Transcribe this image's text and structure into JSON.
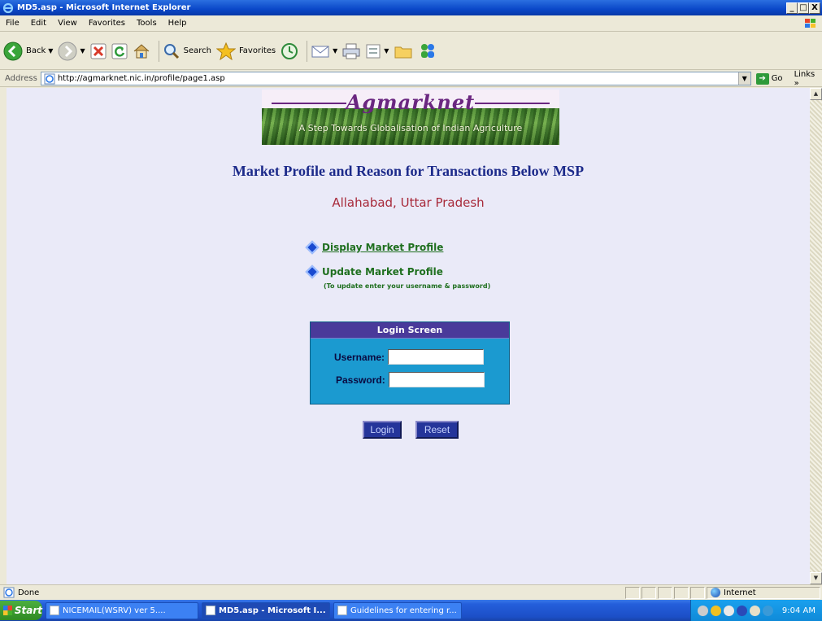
{
  "window": {
    "title": "MD5.asp - Microsoft Internet Explorer",
    "controls": {
      "minimize": "_",
      "maximize": "□",
      "close": "X"
    }
  },
  "menubar": {
    "items": [
      "File",
      "Edit",
      "View",
      "Favorites",
      "Tools",
      "Help"
    ]
  },
  "toolbar": {
    "back_label": "Back",
    "search_label": "Search",
    "favorites_label": "Favorites"
  },
  "address": {
    "label": "Address",
    "url": "http://agmarknet.nic.in/profile/page1.asp",
    "go_label": "Go",
    "links_label": "Links »"
  },
  "page": {
    "brand": "Agmarknet",
    "tagline": "A Step Towards Globalisation of Indian Agriculture",
    "heading": "Market Profile and Reason for Transactions Below MSP",
    "location": "Allahabad, Uttar Pradesh",
    "links": [
      {
        "label": "Display Market Profile"
      },
      {
        "label": "Update Market Profile"
      }
    ],
    "update_note": "(To update enter your username & password)",
    "login": {
      "title": "Login Screen",
      "username_label": "Username:",
      "password_label": "Password:",
      "username_value": "",
      "password_value": "",
      "login_button": "Login",
      "reset_button": "Reset"
    }
  },
  "statusbar": {
    "status": "Done",
    "zone": "Internet"
  },
  "taskbar": {
    "start": "Start",
    "tasks": [
      {
        "label": "NICEMAIL(WSRV) ver 5....",
        "active": false
      },
      {
        "label": "MD5.asp - Microsoft I...",
        "active": true
      },
      {
        "label": "Guidelines for entering r...",
        "active": false
      }
    ],
    "clock": "9:04 AM"
  }
}
